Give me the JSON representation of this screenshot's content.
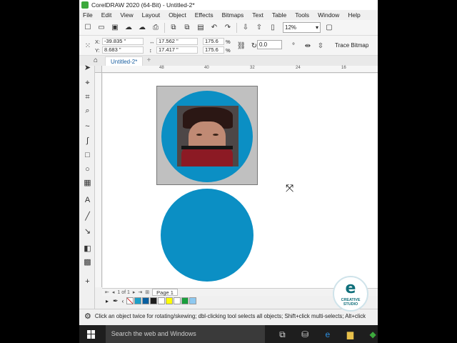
{
  "window": {
    "title": "CorelDRAW 2020 (64-Bit) - Untitled-2*"
  },
  "menu": [
    "File",
    "Edit",
    "View",
    "Layout",
    "Object",
    "Effects",
    "Bitmaps",
    "Text",
    "Table",
    "Tools",
    "Window",
    "Help"
  ],
  "toolbar": {
    "zoom": "12%"
  },
  "property_bar": {
    "x_label": "X:",
    "x_value": "-39.835 \"",
    "y_label": "Y:",
    "y_value": "8.683 \"",
    "width_value": "17.562 \"",
    "height_value": "17.417 \"",
    "scale_w": "175.6",
    "scale_h": "175.6",
    "percent": "%",
    "rotation": "0.0",
    "trace_label": "Trace Bitmap"
  },
  "tabs": {
    "document": "Untitled-2*"
  },
  "ruler": {
    "h_ticks": [
      "48",
      "40",
      "32",
      "24",
      "16"
    ]
  },
  "page_nav": {
    "counter": "1 of 1",
    "page_label": "Page 1"
  },
  "palette": [
    "#ffffff",
    "#1ca0c8",
    "#0a5fa0",
    "#1c1c1c",
    "#ffffff",
    "#ffff00",
    "#ffffff",
    "#1a9f3c",
    "#8dc8f0"
  ],
  "status": {
    "hint": "Click an object twice for rotating/skewing; dbl-clicking tool selects all objects; Shift+click multi-selects; Alt+click"
  },
  "watermark": {
    "line1": "CREATIVE",
    "line2": "STUDIO"
  },
  "taskbar": {
    "search_placeholder": "Search the web and Windows"
  },
  "colors": {
    "circle": "#0b8fc4",
    "bitmap_bg": "#c0c0c0"
  }
}
